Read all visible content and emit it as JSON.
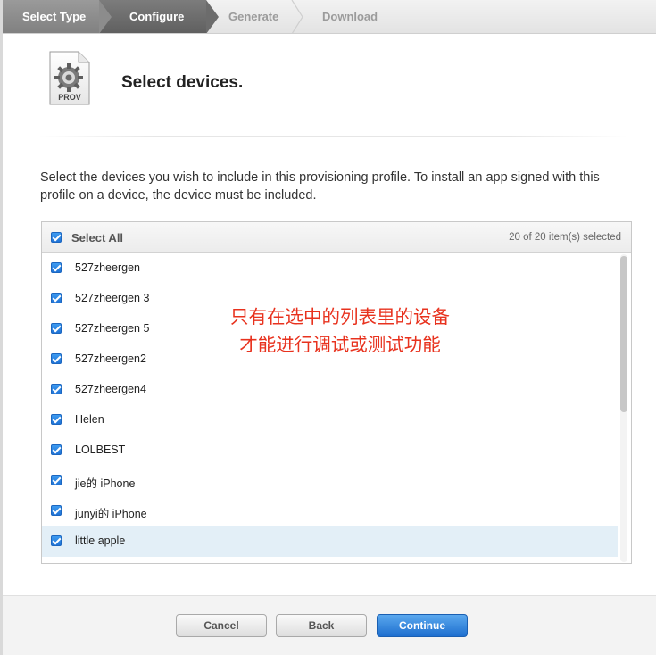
{
  "steps": [
    "Select Type",
    "Configure",
    "Generate",
    "Download"
  ],
  "header": {
    "icon_label": "PROV",
    "title": "Select devices."
  },
  "description": "Select the devices you wish to include in this provisioning profile. To install an app signed with this profile on a device, the device must be included.",
  "device_list": {
    "select_all_label": "Select All",
    "count_text": "20 of 20 item(s) selected",
    "devices": [
      {
        "name": "527zheergen",
        "checked": true
      },
      {
        "name": "527zheergen 3",
        "checked": true
      },
      {
        "name": "527zheergen 5",
        "checked": true
      },
      {
        "name": "527zheergen2",
        "checked": true
      },
      {
        "name": "527zheergen4",
        "checked": true
      },
      {
        "name": "Helen",
        "checked": true
      },
      {
        "name": "LOLBEST",
        "checked": true
      },
      {
        "name": "jie的 iPhone",
        "checked": true
      },
      {
        "name": "junyi的 iPhone",
        "checked": true
      },
      {
        "name": "little apple",
        "checked": true,
        "highlighted": true
      }
    ]
  },
  "annotation": {
    "line1": "只有在选中的列表里的设备",
    "line2": "才能进行调试或测试功能",
    "color": "#e8321e"
  },
  "footer": {
    "cancel_label": "Cancel",
    "back_label": "Back",
    "continue_label": "Continue"
  },
  "colors": {
    "accent_blue": "#1e6fcf",
    "row_highlight": "#e3eff7"
  }
}
